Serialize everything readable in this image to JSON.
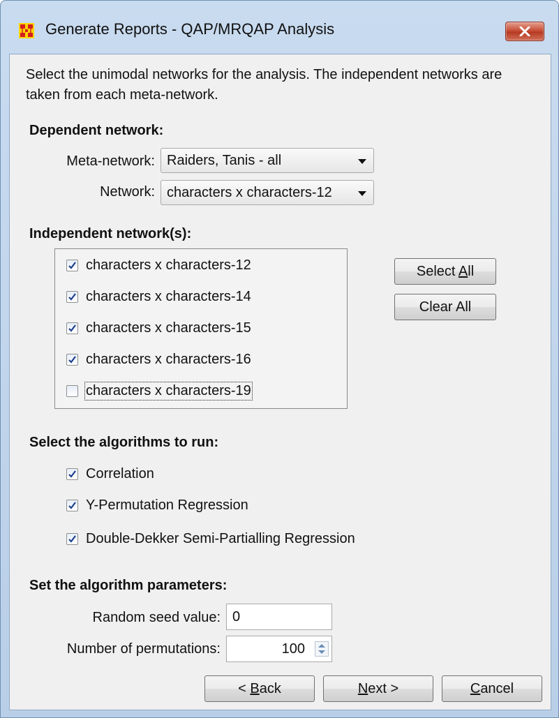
{
  "window": {
    "title": "Generate Reports - QAP/MRQAP Analysis"
  },
  "intro_text": "Select the unimodal networks for the analysis. The independent networks are taken from each meta-network.",
  "dependent": {
    "heading": "Dependent network:",
    "meta_network_label": "Meta-network:",
    "meta_network_value": "Raiders, Tanis - all",
    "network_label": "Network:",
    "network_value": "characters x characters-12"
  },
  "independent": {
    "heading": "Independent network(s):",
    "items": [
      {
        "label": "characters x characters-12",
        "checked": true
      },
      {
        "label": "characters x characters-14",
        "checked": true
      },
      {
        "label": "characters x characters-15",
        "checked": true
      },
      {
        "label": "characters x characters-16",
        "checked": true
      },
      {
        "label": "characters x characters-19",
        "checked": false
      }
    ],
    "select_all_pre": "Select ",
    "select_all_mnemonic": "A",
    "select_all_post": "ll",
    "clear_all_label": "Clear All"
  },
  "algorithms": {
    "heading": "Select the algorithms to run:",
    "items": [
      {
        "label": "Correlation",
        "checked": true
      },
      {
        "label": "Y-Permutation Regression",
        "checked": true
      },
      {
        "label": "Double-Dekker Semi-Partialling Regression",
        "checked": true
      }
    ]
  },
  "parameters": {
    "heading": "Set the algorithm parameters:",
    "seed_label": "Random seed value:",
    "seed_value": "0",
    "permutations_label": "Number of permutations:",
    "permutations_value": "100"
  },
  "footer": {
    "back_pre": "< ",
    "back_mnemonic": "B",
    "back_post": "ack",
    "next_mnemonic": "N",
    "next_post": "ext >",
    "cancel_mnemonic": "C",
    "cancel_post": "ancel"
  },
  "colors": {
    "title_gradient": "#c9dbef",
    "close_button": "#c85038",
    "client_bg": "#f0f0f0",
    "check_mark": "#1e3f8c"
  },
  "icons": {
    "app": "orgchart-grid-icon",
    "close": "close-x-icon",
    "dropdown": "dropdown-arrow-icon",
    "spinner": "spinner-arrows-icon",
    "check": "checkmark-icon"
  }
}
